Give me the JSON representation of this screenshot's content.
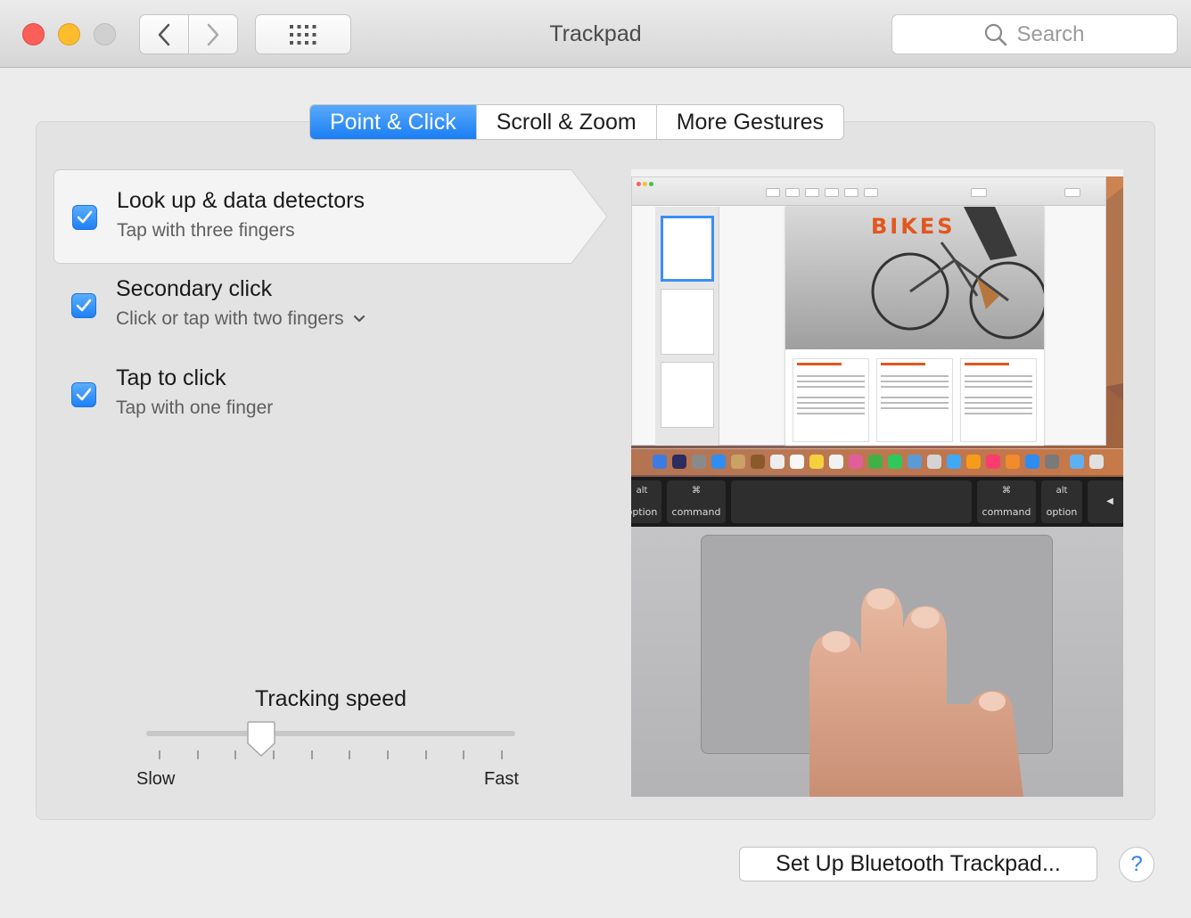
{
  "window": {
    "title": "Trackpad",
    "search_placeholder": "Search"
  },
  "tabs": [
    {
      "label": "Point & Click",
      "active": true
    },
    {
      "label": "Scroll & Zoom",
      "active": false
    },
    {
      "label": "More Gestures",
      "active": false
    }
  ],
  "options": [
    {
      "title": "Look up & data detectors",
      "subtitle": "Tap with three fingers",
      "checked": true,
      "selected": true
    },
    {
      "title": "Secondary click",
      "subtitle": "Click or tap with two fingers",
      "checked": true,
      "selected": false
    },
    {
      "title": "Tap to click",
      "subtitle": "Tap with one finger",
      "checked": true,
      "selected": false
    }
  ],
  "tracking": {
    "label": "Tracking speed",
    "min_label": "Slow",
    "max_label": "Fast",
    "value_fraction": 0.3
  },
  "preview": {
    "doc_title": "BIKES",
    "keys": [
      "alt",
      "option",
      "command",
      "command",
      "alt",
      "option"
    ]
  },
  "footer": {
    "setup_button": "Set Up Bluetooth Trackpad...",
    "help_label": "?"
  },
  "colors": {
    "accent": "#1a7ef4",
    "close": "#fc5f57",
    "minimize": "#fdbc2e"
  }
}
